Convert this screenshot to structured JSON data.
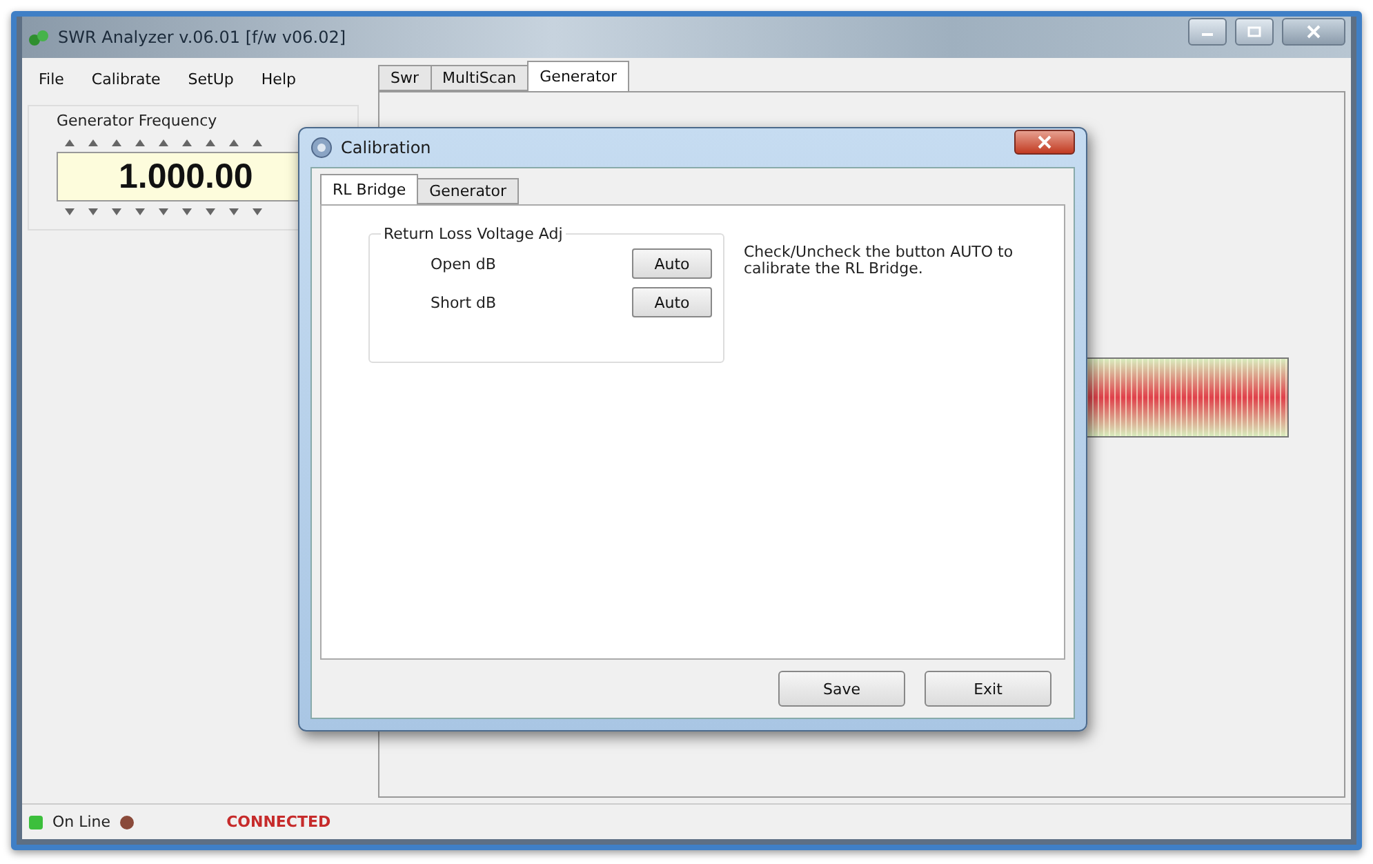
{
  "window": {
    "title": "SWR Analyzer v.06.01 [f/w v06.02]"
  },
  "menu": [
    "File",
    "Calibrate",
    "SetUp",
    "Help"
  ],
  "tabs": [
    {
      "label": "Swr",
      "selected": false
    },
    {
      "label": "MultiScan",
      "selected": false
    },
    {
      "label": "Generator",
      "selected": true
    }
  ],
  "generator": {
    "label": "Generator Frequency",
    "value": "1.000.00"
  },
  "dialog": {
    "title": "Calibration",
    "tabs": [
      {
        "label": "RL Bridge",
        "selected": true
      },
      {
        "label": "Generator",
        "selected": false
      }
    ],
    "group": {
      "title": "Return Loss Voltage Adj",
      "rows": [
        {
          "label": "Open dB",
          "button": "Auto"
        },
        {
          "label": "Short dB",
          "button": "Auto"
        }
      ]
    },
    "hint": "Check/Uncheck the button AUTO to calibrate the RL Bridge.",
    "buttons": [
      "Save",
      "Exit"
    ]
  },
  "status_bar": {
    "online": "On Line",
    "connection": "CONNECTED"
  }
}
